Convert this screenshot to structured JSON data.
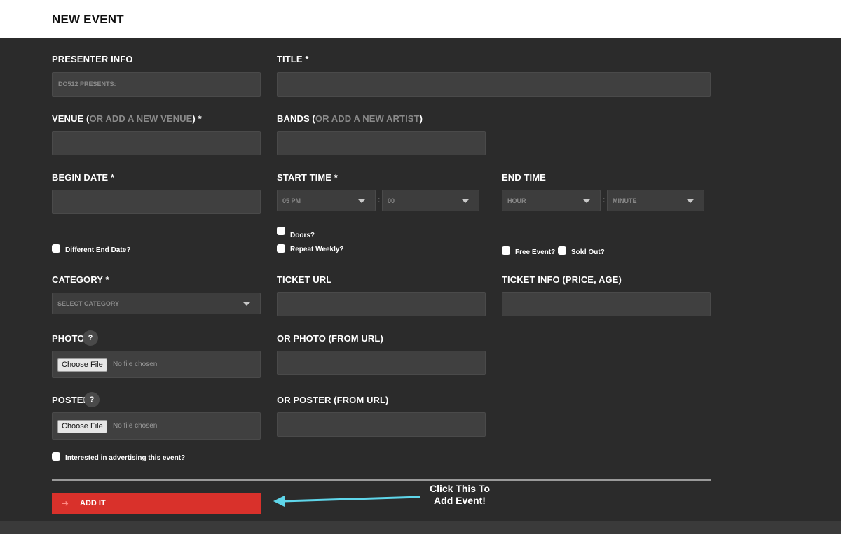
{
  "header": {
    "title": "NEW EVENT"
  },
  "presenter": {
    "label": "PRESENTER INFO",
    "placeholder": "DO512 PRESENTS:"
  },
  "title_field": {
    "label": "TITLE *"
  },
  "venue": {
    "label_prefix": "VENUE (",
    "link": "OR ADD A NEW VENUE",
    "label_suffix": ") *"
  },
  "bands": {
    "label_prefix": "BANDS (",
    "link": "OR ADD A NEW ARTIST",
    "label_suffix": ")"
  },
  "begin_date": {
    "label": "BEGIN DATE *"
  },
  "start_time": {
    "label": "START TIME *",
    "hour": "05 PM",
    "minute": "00",
    "separator": ":"
  },
  "end_time": {
    "label": "END TIME",
    "hour": "HOUR",
    "minute": "MINUTE",
    "separator": ":"
  },
  "checkboxes": {
    "doors": "Doors?",
    "different_end_date": "Different End Date?",
    "repeat_weekly": "Repeat Weekly?",
    "free_event": "Free Event?",
    "sold_out": "Sold Out?",
    "advertising": "Interested in advertising this event?"
  },
  "category": {
    "label": "CATEGORY *",
    "value": "SELECT CATEGORY"
  },
  "ticket_url": {
    "label": "TICKET URL"
  },
  "ticket_info": {
    "label": "TICKET INFO (PRICE, AGE)"
  },
  "photo": {
    "label": "PHOTO",
    "help": "?",
    "button": "Choose File",
    "status": "No file chosen"
  },
  "photo_url": {
    "label": "OR PHOTO (FROM URL)"
  },
  "poster": {
    "label": "POSTER",
    "help": "?",
    "button": "Choose File",
    "status": "No file chosen"
  },
  "poster_url": {
    "label": "OR POSTER (FROM URL)"
  },
  "submit": {
    "label": "ADD IT",
    "icon": "arrow-right-icon"
  },
  "annotation": {
    "line1": "Click This To",
    "line2": "Add Event!",
    "color": "#5fd6ea"
  },
  "colors": {
    "accent": "#d9312b",
    "background": "#2b2b2b",
    "field": "#404040"
  }
}
